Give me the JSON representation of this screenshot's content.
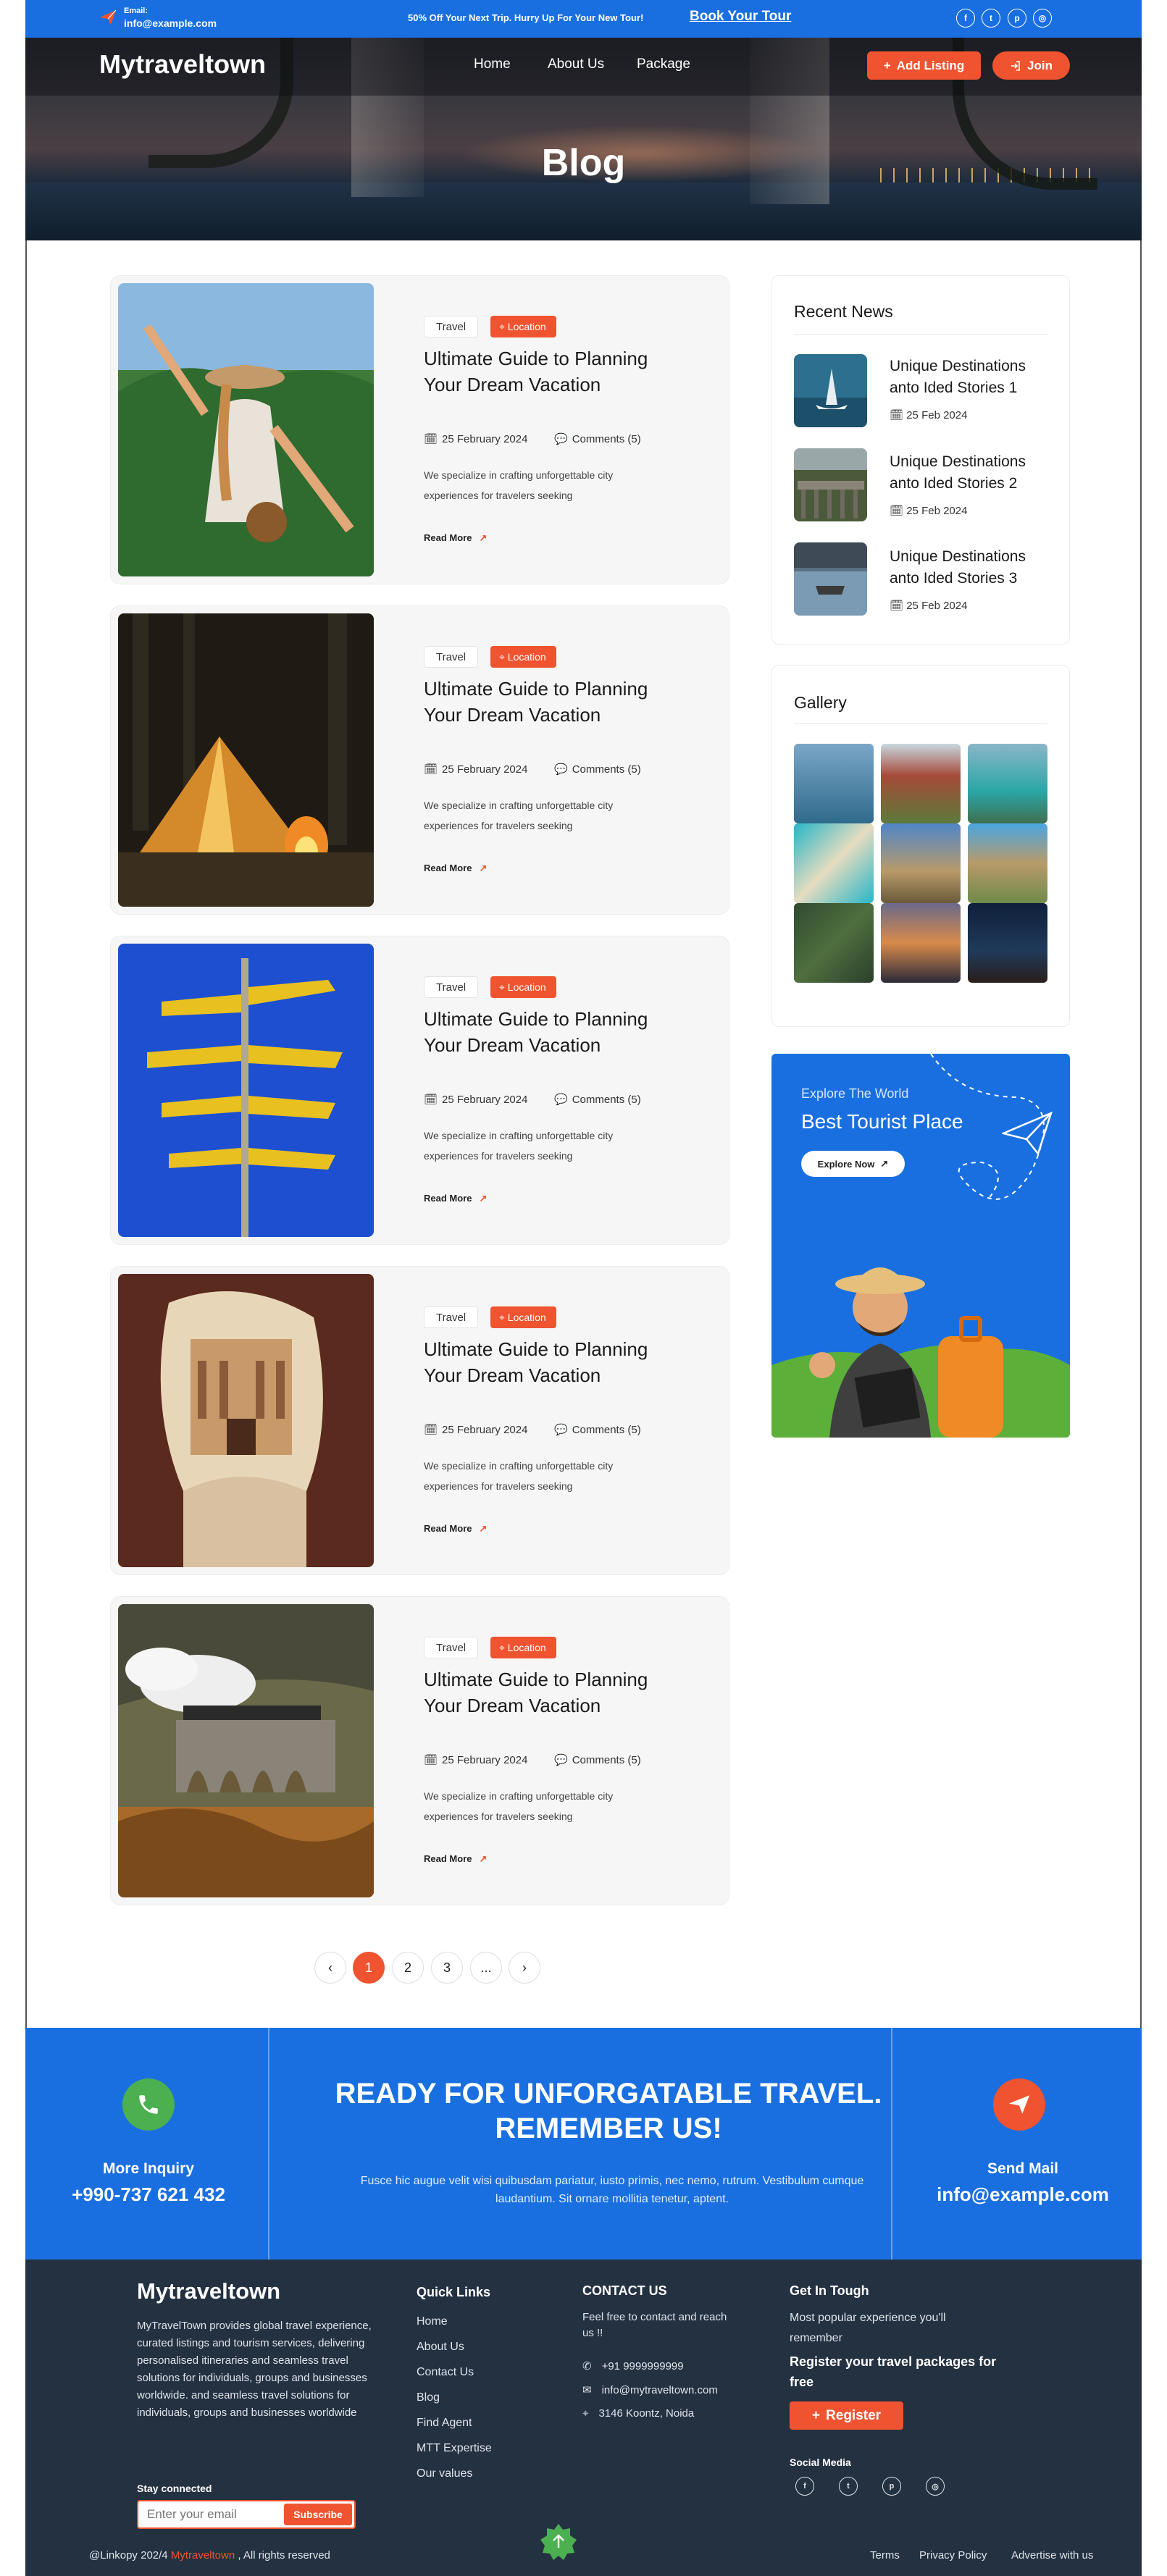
{
  "topbar": {
    "email_label": "Email:",
    "email": "info@example.com",
    "promo": "50% Off Your Next Trip. Hurry Up For Your New Tour!",
    "book_label": "Book Your Tour",
    "social": [
      "facebook-icon",
      "twitter-icon",
      "pinterest-icon",
      "instagram-icon"
    ]
  },
  "header": {
    "logo": "Mytraveltown",
    "nav": [
      "Home",
      "About Us",
      "Package"
    ],
    "add_listing": "Add Listing",
    "join": "Join"
  },
  "hero": {
    "title": "Blog"
  },
  "posts": [
    {
      "tag": "Travel",
      "location": "Location",
      "title": "Ultimate Guide to Planning Your Dream Vacation",
      "date": "25 February 2024",
      "comments": "Comments (5)",
      "description": "We specialize in crafting unforgettable city experiences for travelers seeking",
      "read_more": "Read More",
      "image": "woman-hiker-photo"
    },
    {
      "tag": "Travel",
      "location": "Location",
      "title": "Ultimate Guide to Planning Your Dream Vacation",
      "date": "25 February 2024",
      "comments": "Comments (5)",
      "description": "We specialize in crafting unforgettable city experiences for travelers seeking",
      "read_more": "Read More",
      "image": "tent-campfire-photo"
    },
    {
      "tag": "Travel",
      "location": "Location",
      "title": "Ultimate Guide to Planning Your Dream Vacation",
      "date": "25 February 2024",
      "comments": "Comments (5)",
      "description": "We specialize in crafting unforgettable city experiences for travelers seeking",
      "read_more": "Read More",
      "image": "signpost-photo"
    },
    {
      "tag": "Travel",
      "location": "Location",
      "title": "Ultimate Guide to Planning Your Dream Vacation",
      "date": "25 February 2024",
      "comments": "Comments (5)",
      "description": "We specialize in crafting unforgettable city experiences for travelers seeking",
      "read_more": "Read More",
      "image": "petra-cave-photo"
    },
    {
      "tag": "Travel",
      "location": "Location",
      "title": "Ultimate Guide to Planning Your Dream Vacation",
      "date": "25 February 2024",
      "comments": "Comments (5)",
      "description": "We specialize in crafting unforgettable city experiences for travelers seeking",
      "read_more": "Read More",
      "image": "steam-train-viaduct-photo"
    }
  ],
  "pagination": {
    "prev": "‹",
    "pages": [
      "1",
      "2",
      "3",
      "..."
    ],
    "next": "›",
    "active": "1"
  },
  "sidebar": {
    "recent_title": "Recent News",
    "news": [
      {
        "title": "Unique Destinations anto Ided Stories 1",
        "date": "25 Feb 2024"
      },
      {
        "title": "Unique Destinations anto Ided Stories 2",
        "date": "25 Feb 2024"
      },
      {
        "title": "Unique Destinations anto Ided Stories 3",
        "date": "25 Feb 2024"
      }
    ],
    "gallery_title": "Gallery",
    "promo": {
      "subtitle": "Explore The World",
      "title": "Best Tourist Place",
      "button": "Explore Now"
    }
  },
  "cta": {
    "left_label": "More Inquiry",
    "phone": "+990-737 621 432",
    "heading": "READY FOR UNFORGATABLE TRAVEL. REMEMBER US!",
    "text": "Fusce hic augue velit wisi quibusdam pariatur, iusto primis, nec nemo, rutrum. Vestibulum cumque laudantium. Sit ornare mollitia tenetur, aptent.",
    "right_label": "Send Mail",
    "email": "info@example.com"
  },
  "footer": {
    "logo": "Mytraveltown",
    "about": "MyTravelTown provides global travel experience, curated listings and tourism services, delivering personalised itineraries and seamless travel solutions for individuals, groups and businesses worldwide.  and seamless travel solutions for individuals, groups and businesses worldwide",
    "stay_connected": "Stay connected",
    "email_placeholder": "Enter your email",
    "subscribe": "Subscribe",
    "quick_links_title": "Quick Links",
    "quick_links": [
      "Home",
      "About Us",
      "Contact Us",
      "Blog",
      "Find Agent",
      "MTT Expertise",
      "Our values"
    ],
    "contact_title": "CONTACT US",
    "contact_text": "Feel free to contact and reach us !!",
    "phone": "+91 9999999999",
    "email": "info@mytraveltown.com",
    "address": "3146 Koontz, Noida",
    "get_title": "Get In Tough",
    "get_text": "Most popular experience you'll remember",
    "get_bold": "Register your travel packages for free",
    "register": "Register",
    "social_label": "Social Media",
    "copy_prefix": "@Linkopy 202/4",
    "copy_brand": "Mytraveltown",
    "copy_suffix": ", All rights reserved",
    "bottom_links": [
      "Terms",
      "Privacy Policy",
      "Advertise with us"
    ]
  },
  "colors": {
    "primary_blue": "#1a6fe0",
    "accent_orange": "#f0532f",
    "footer_dark": "#243141",
    "cta_green": "#4caf50"
  }
}
